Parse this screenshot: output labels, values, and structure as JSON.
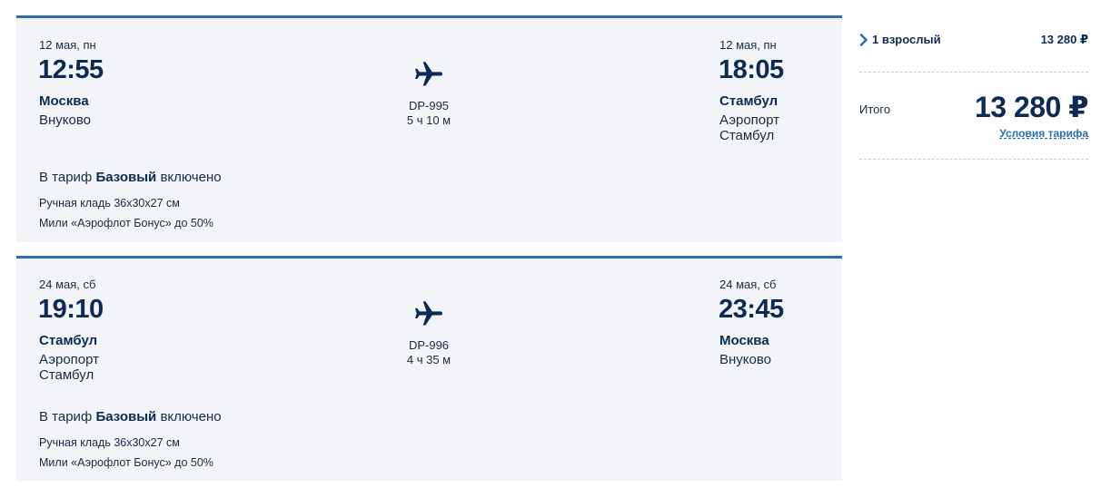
{
  "flights": [
    {
      "departure": {
        "date": "12 мая, пн",
        "time": "12:55",
        "city": "Москва",
        "airport": "Внуково"
      },
      "flight_number": "DP-995",
      "duration": "5 ч 10 м",
      "arrival": {
        "date": "12 мая, пн",
        "time": "18:05",
        "city": "Стамбул",
        "airport_line1": "Аэропорт",
        "airport_line2": "Стамбул"
      },
      "tariff": {
        "prefix": "В тариф",
        "name": "Базовый",
        "suffix": "включено"
      },
      "perks": [
        "Ручная кладь 36х30х27 см",
        "Мили «Аэрофлот Бонус» до 50%"
      ]
    },
    {
      "departure": {
        "date": "24 мая, сб",
        "time": "19:10",
        "city": "Стамбул",
        "airport_line1": "Аэропорт",
        "airport_line2": "Стамбул"
      },
      "flight_number": "DP-996",
      "duration": "4 ч 35 м",
      "arrival": {
        "date": "24 мая, сб",
        "time": "23:45",
        "city": "Москва",
        "airport": "Внуково"
      },
      "tariff": {
        "prefix": "В тариф",
        "name": "Базовый",
        "suffix": "включено"
      },
      "perks": [
        "Ручная кладь 36х30х27 см",
        "Мили «Аэрофлот Бонус» до 50%"
      ]
    }
  ],
  "summary": {
    "passengers_label": "1 взрослый",
    "passengers_price": "13 280 ₽",
    "total_label": "Итого",
    "total_price": "13 280 ₽",
    "terms_link": "Условия тарифа"
  },
  "icons": {
    "plane": "airplane-icon",
    "chevron": "chevron-right-icon"
  },
  "colors": {
    "accent": "#2b6fb3",
    "dark_text": "#0d2a55",
    "card_bg": "#f2f4f7"
  }
}
